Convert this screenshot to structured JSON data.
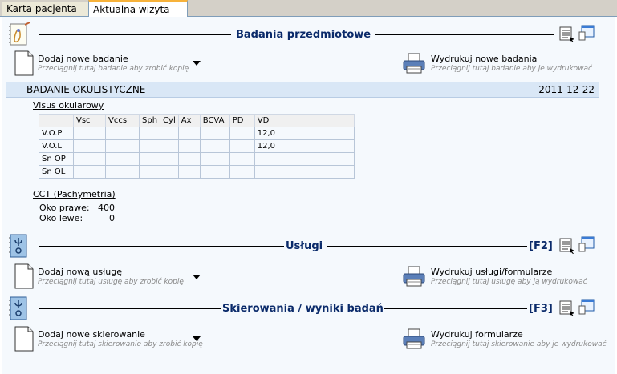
{
  "tabs": [
    {
      "label": "Karta pacjenta",
      "active": false
    },
    {
      "label": "Aktualna wizyta",
      "active": true
    }
  ],
  "sections": {
    "badania": {
      "title": "Badania przedmiotowe",
      "fkey": "",
      "add_label": "Dodaj nowe badanie",
      "add_hint": "Przeciągnij tutaj badanie aby zrobić kopię",
      "print_label": "Wydrukuj nowe badania",
      "print_hint": "Przeciągnij tutaj badanie aby je wydrukować"
    },
    "uslugi": {
      "title": "Usługi",
      "fkey": "[F2]",
      "add_label": "Dodaj nową usługę",
      "add_hint": "Przeciągnij tutaj usługę aby zrobić kopię",
      "print_label": "Wydrukuj usługi/formularze",
      "print_hint": "Przeciągnij tutaj usługę aby ją wydrukować"
    },
    "skierowania": {
      "title": "Skierowania / wyniki badań",
      "fkey": "[F3]",
      "add_label": "Dodaj nowe skierowanie",
      "add_hint": "Przeciągnij tutaj skierowanie aby zrobić kopię",
      "print_label": "Wydrukuj formularze",
      "print_hint": "Przeciągnij tutaj skierowanie aby je wydrukować"
    }
  },
  "exam": {
    "name": "BADANIE OKULISTYCZNE",
    "date": "2011-12-22",
    "visus_title": "Visus okularowy",
    "columns": [
      "",
      "Vsc",
      "Vccs",
      "Sph",
      "Cyl",
      "Ax",
      "BCVA",
      "PD",
      "VD",
      ""
    ],
    "rows": [
      [
        "V.O.P",
        "",
        "",
        "",
        "",
        "",
        "",
        "",
        "12,0",
        ""
      ],
      [
        "V.O.L",
        "",
        "",
        "",
        "",
        "",
        "",
        "",
        "12,0",
        ""
      ],
      [
        "Sn OP",
        "",
        "",
        "",
        "",
        "",
        "",
        "",
        "",
        ""
      ],
      [
        "Sn OL",
        "",
        "",
        "",
        "",
        "",
        "",
        "",
        "",
        ""
      ]
    ],
    "cct_title": "CCT (Pachymetria)",
    "cct": [
      {
        "label": "Oko prawe:",
        "value": "400"
      },
      {
        "label": "Oko lewe:",
        "value": "0"
      }
    ]
  }
}
